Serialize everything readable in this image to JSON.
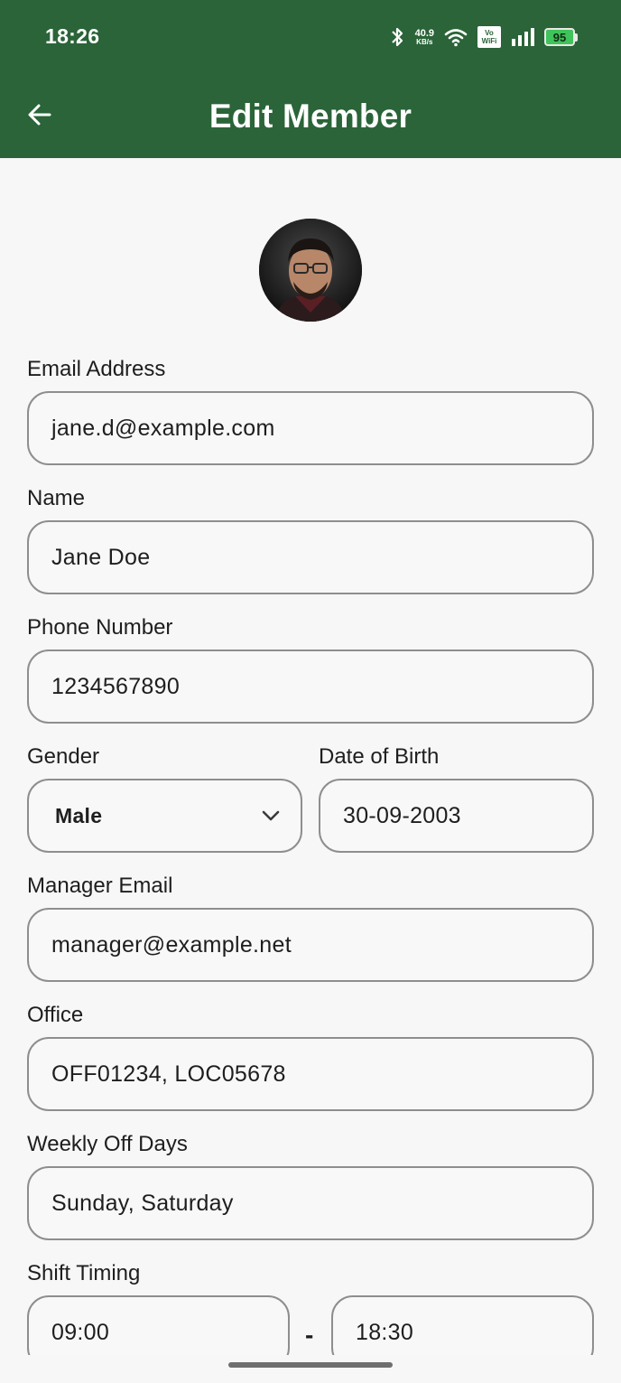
{
  "status_bar": {
    "time": "18:26",
    "net_speed_value": "40.9",
    "net_speed_unit": "KB/s",
    "vowifi_top": "Vo",
    "vowifi_bottom": "WiFi",
    "battery": "95"
  },
  "header": {
    "title": "Edit Member",
    "back_icon": "arrow-left-icon",
    "background": "#2a6438"
  },
  "form": {
    "email": {
      "label": "Email Address",
      "value": "jane.d@example.com"
    },
    "name": {
      "label": "Name",
      "value": "Jane Doe"
    },
    "phone": {
      "label": "Phone Number",
      "value": "1234567890"
    },
    "gender": {
      "label": "Gender",
      "value": "Male"
    },
    "dob": {
      "label": "Date of Birth",
      "value": "30-09-2003"
    },
    "manager_email": {
      "label": "Manager Email",
      "value": "manager@example.net"
    },
    "office": {
      "label": "Office",
      "value": "OFF01234, LOC05678"
    },
    "weekly_off": {
      "label": "Weekly Off Days",
      "value": "Sunday, Saturday"
    },
    "shift": {
      "label": "Shift Timing",
      "start": "09:00",
      "separator": "-",
      "end": "18:30"
    }
  }
}
